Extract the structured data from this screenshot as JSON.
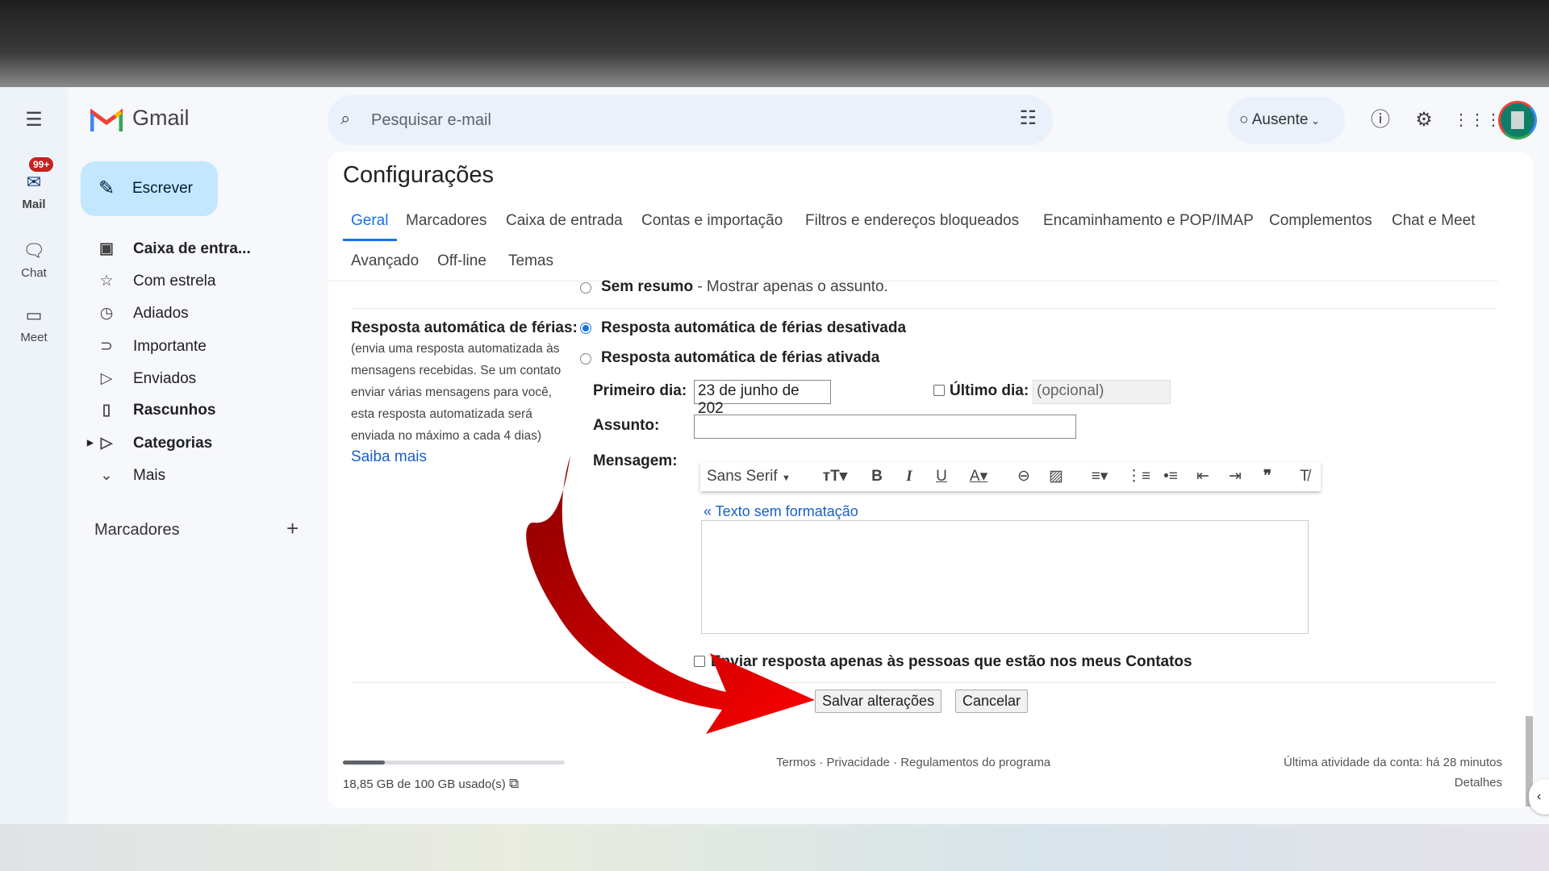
{
  "app": {
    "name": "Gmail",
    "search_placeholder": "Pesquisar e-mail",
    "status": "Ausente",
    "accent": "#1a73e8",
    "arrow_color": "#d40000"
  },
  "rail": {
    "mail": "Mail",
    "badge": "99+",
    "chat": "Chat",
    "meet": "Meet"
  },
  "compose": "Escrever",
  "nav": [
    {
      "label": "Caixa de entra...",
      "icon": "inbox-icon"
    },
    {
      "label": "Com estrela",
      "icon": "star-icon"
    },
    {
      "label": "Adiados",
      "icon": "clock-icon"
    },
    {
      "label": "Importante",
      "icon": "important-icon"
    },
    {
      "label": "Enviados",
      "icon": "send-icon"
    },
    {
      "label": "Rascunhos",
      "icon": "draft-icon"
    },
    {
      "label": "Categorias",
      "icon": "label-icon"
    },
    {
      "label": "Mais",
      "icon": "chevron-down-icon"
    }
  ],
  "labels_header": "Marcadores",
  "settings": {
    "title": "Configurações",
    "tabs": [
      "Geral",
      "Marcadores",
      "Caixa de entrada",
      "Contas e importação",
      "Filtros e endereços bloqueados",
      "Encaminhamento e POP/IMAP",
      "Complementos",
      "Chat e Meet"
    ],
    "tabs2": [
      "Avançado",
      "Off-line",
      "Temas"
    ],
    "sem_resumo_bold": "Sem resumo",
    "sem_resumo_rest": " - Mostrar apenas o assunto.",
    "vacation_label": "Resposta automática de férias:",
    "vacation_desc": "(envia uma resposta automatizada às mensagens recebidas. Se um contato enviar várias mensagens para você, esta resposta automatizada será enviada no máximo a cada 4 dias)",
    "saiba_mais": "Saiba mais",
    "opt_off": "Resposta automática de férias desativada",
    "opt_on": "Resposta automática de férias ativada",
    "first_day_label": "Primeiro dia:",
    "first_day_value": "23 de junho de 202",
    "last_day_label": "Último dia:",
    "last_day_placeholder": "(opcional)",
    "subject_label": "Assunto:",
    "message_label": "Mensagem:",
    "font": "Sans Serif",
    "plain_text": "« Texto sem formatação",
    "contacts_only": "Enviar resposta apenas às pessoas que estão nos meus Contatos",
    "save": "Salvar alterações",
    "cancel": "Cancelar"
  },
  "footer": {
    "storage": "18,85 GB de 100 GB usado(s)",
    "storage_used_fraction": 0.1885,
    "links": "Termos · Privacidade · Regulamentos do programa",
    "activity": "Última atividade da conta: há 28 minutos",
    "details": "Detalhes"
  }
}
